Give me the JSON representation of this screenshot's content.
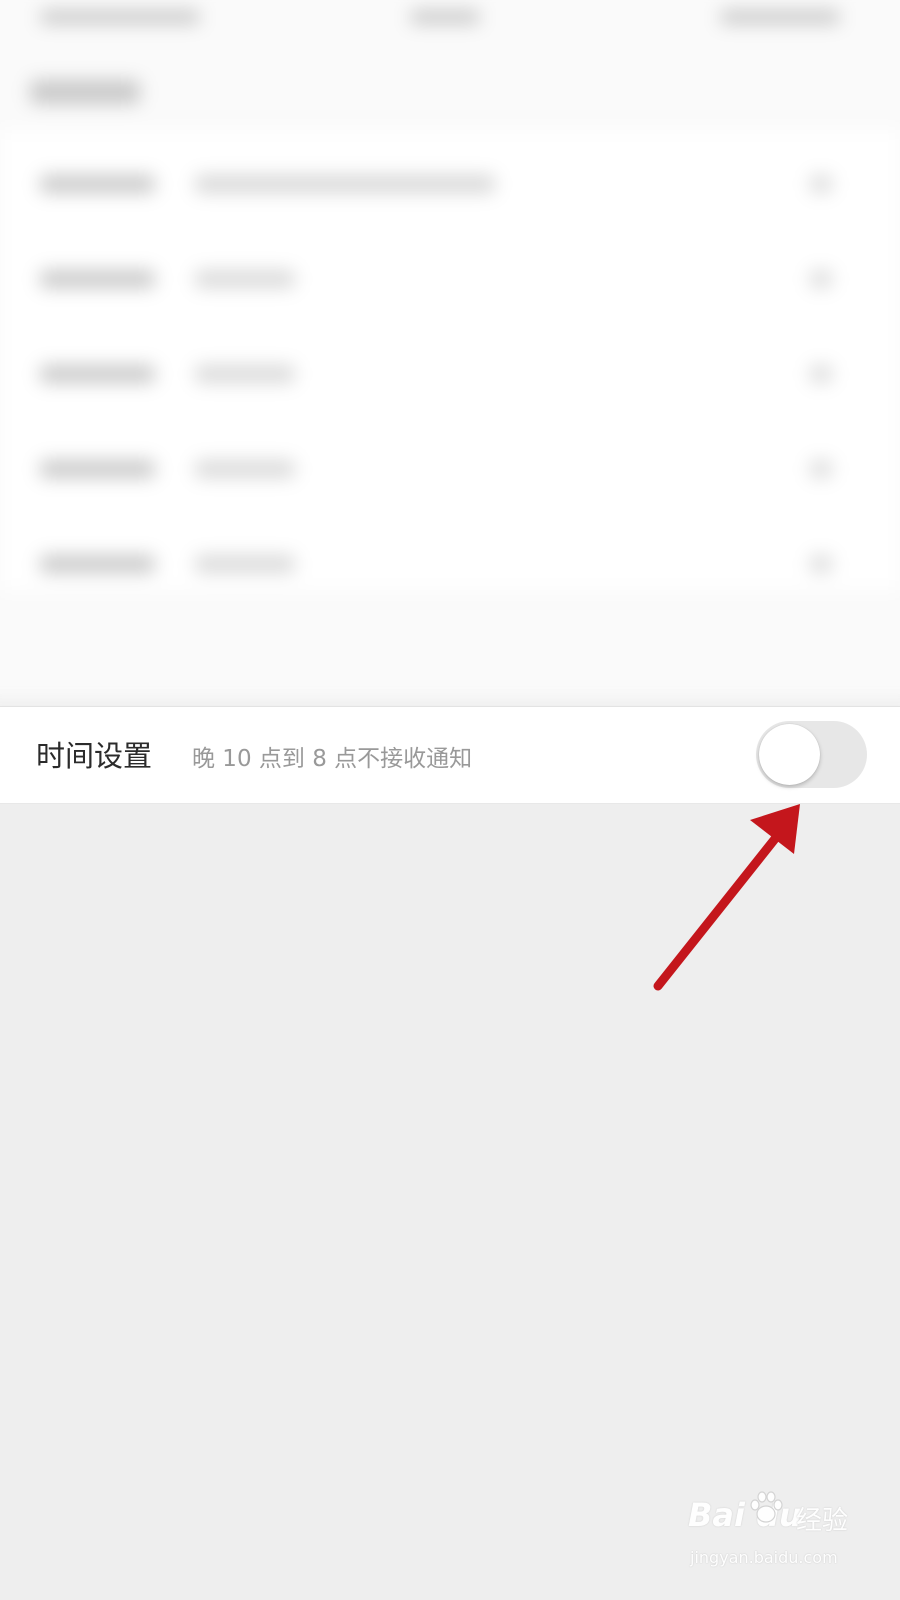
{
  "setting": {
    "title": "时间设置",
    "description": "晚 10 点到 8 点不接收通知",
    "toggle_on": false
  },
  "annotation": {
    "arrow_color": "#c4161c"
  },
  "watermark": {
    "logo": "Bai  du",
    "product": "经验",
    "url": "jingyan.baidu.com"
  }
}
